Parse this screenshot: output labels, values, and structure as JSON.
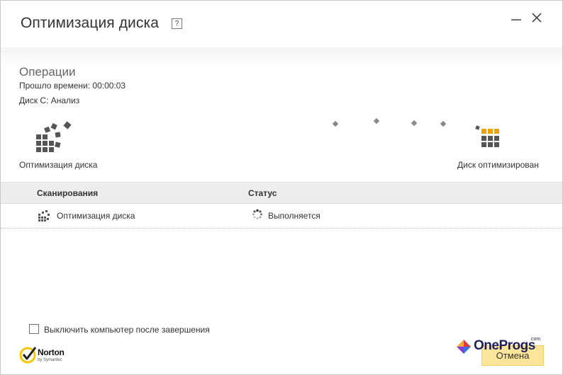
{
  "window": {
    "title": "Оптимизация диска",
    "help_label": "?"
  },
  "operations": {
    "heading": "Операции",
    "elapsed": "Прошло времени: 00:00:03",
    "drive_status": "Диск C: Анализ",
    "source_label": "Оптимизация диска",
    "target_label": "Диск оптимизирован"
  },
  "table": {
    "columns": [
      "Сканирования",
      "Статус"
    ],
    "rows": [
      {
        "name": "Оптимизация диска",
        "status": "Выполняется"
      }
    ]
  },
  "footer": {
    "shutdown_label": "Выключить компьютер после завершения",
    "shutdown_checked": false,
    "brand_name": "Norton",
    "brand_sub": "by Symantec",
    "cancel_label": "Отмена",
    "watermark_name": "OneProgs",
    "watermark_suffix": ".com"
  },
  "colors": {
    "accent_orange": "#f0a000",
    "block_gray": "#555555",
    "button_yellow": "#fbe59a",
    "norton_yellow": "#f7c600"
  },
  "icons": [
    "help-icon",
    "minimize-icon",
    "close-icon",
    "disk-fragments-icon",
    "disk-optimized-icon",
    "disk-small-icon",
    "spinner-icon",
    "norton-check-icon"
  ]
}
